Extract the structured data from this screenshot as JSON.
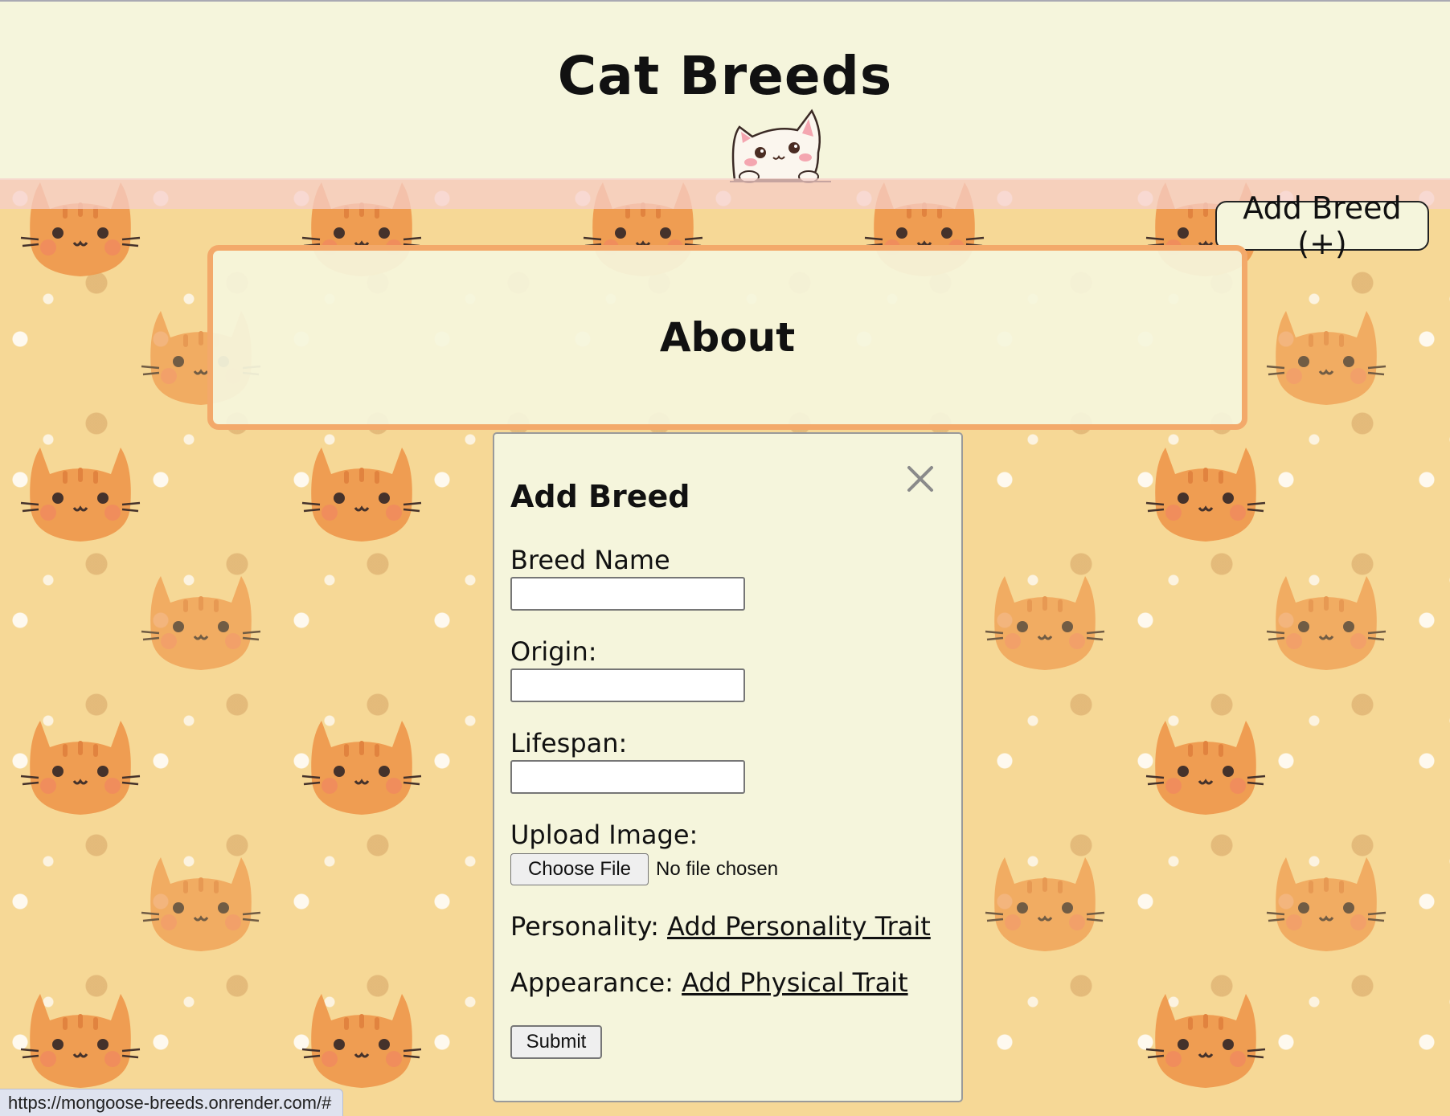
{
  "header": {
    "title": "Cat Breeds",
    "mascot_icon": "peeking-cat-icon"
  },
  "toolbar": {
    "add_breed_label": "Add Breed (+)"
  },
  "about": {
    "title": "About"
  },
  "modal": {
    "title": "Add Breed",
    "close_icon": "close-icon",
    "fields": {
      "breed_name_label": "Breed Name",
      "breed_name_value": "",
      "origin_label": "Origin:",
      "origin_value": "",
      "lifespan_label": "Lifespan:",
      "lifespan_value": "",
      "upload_label": "Upload Image:",
      "choose_file_label": "Choose File",
      "file_status": "No file chosen",
      "personality_label": "Personality:",
      "personality_link": "Add Personality Trait",
      "appearance_label": "Appearance:",
      "appearance_link": "Add Physical Trait"
    },
    "submit_label": "Submit"
  },
  "status_bar": {
    "url": "https://mongoose-breeds.onrender.com/#"
  },
  "colors": {
    "header_bg": "#f5f5dc",
    "page_bg": "#f6d896",
    "about_border": "#f3a96a",
    "cat_orange": "#ef9a4e"
  }
}
